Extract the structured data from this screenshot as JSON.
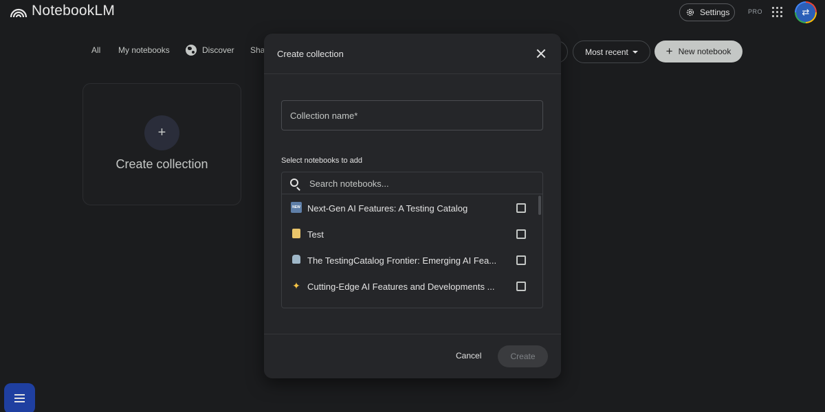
{
  "app": {
    "name": "NotebookLM",
    "settings_label": "Settings",
    "plan_badge": "PRO"
  },
  "tabs": [
    {
      "label": "All"
    },
    {
      "label": "My notebooks"
    },
    {
      "label": "Discover"
    },
    {
      "label": "Shar"
    }
  ],
  "toolbar": {
    "sort_label": "Most recent",
    "new_notebook_label": "New notebook"
  },
  "collection_card": {
    "plus": "+",
    "label": "Create collection"
  },
  "dialog": {
    "title": "Create collection",
    "name_placeholder": "Collection name*",
    "select_label": "Select notebooks to add",
    "search_placeholder": "Search notebooks...",
    "notebooks": [
      {
        "title": "Next-Gen AI Features: A Testing Catalog",
        "icon": "new-badge-icon",
        "checked": false
      },
      {
        "title": "Test",
        "icon": "note-icon",
        "checked": false
      },
      {
        "title": "The TestingCatalog Frontier: Emerging AI Fea...",
        "icon": "robot-icon",
        "checked": false
      },
      {
        "title": "Cutting-Edge AI Features and Developments ...",
        "icon": "sparkles-icon",
        "checked": false
      }
    ],
    "cancel_label": "Cancel",
    "create_label": "Create"
  },
  "colors": {
    "background": "#1b1c1e",
    "dialog": "#252629",
    "accent_fab": "#1f3fa0"
  }
}
